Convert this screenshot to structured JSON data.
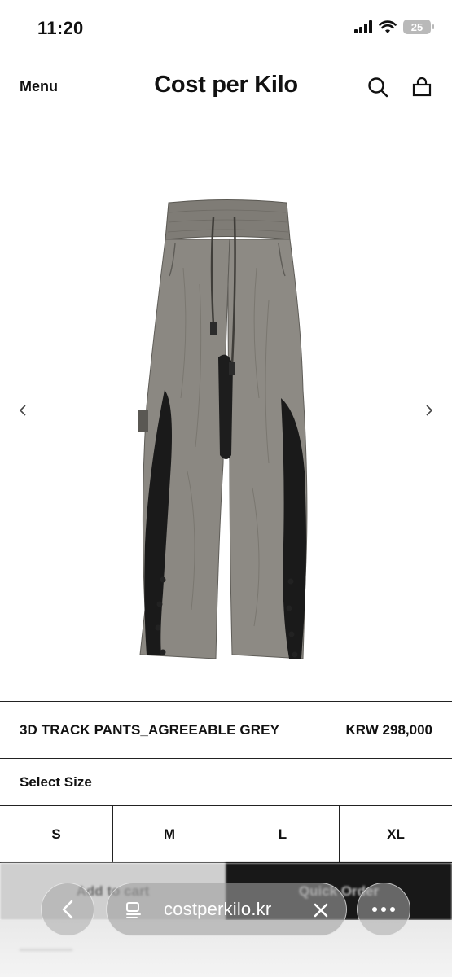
{
  "status_bar": {
    "time": "11:20",
    "battery": "25"
  },
  "header": {
    "menu_label": "Menu",
    "site_title": "Cost per Kilo",
    "search_icon": "search-icon",
    "bag_icon": "shopping-bag-icon"
  },
  "product": {
    "name": "3D TRACK PANTS_AGREEABLE GREY",
    "price": "KRW 298,000",
    "image_alt": "3D Track Pants in agreeable grey with black side panels",
    "colors": {
      "pant_grey": "#8a8780",
      "panel_black": "#1a1a1a"
    }
  },
  "size_selector": {
    "label": "Select Size",
    "options": [
      "S",
      "M",
      "L",
      "XL"
    ]
  },
  "actions": {
    "add_to_cart": "Add to cart",
    "quick_order": "Quick Order"
  },
  "browser": {
    "url": "costperkilo.kr"
  }
}
